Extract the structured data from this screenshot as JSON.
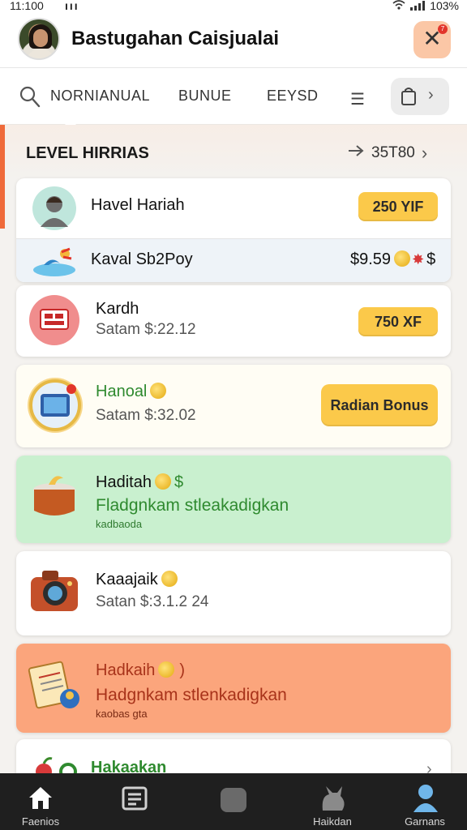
{
  "status_bar": {
    "time": "11:100",
    "icons_left": "ııı",
    "battery": "103%"
  },
  "header": {
    "title": "Bastugahan Caisjualai",
    "notification_count": "7"
  },
  "tabs": {
    "items": [
      {
        "label": "NORNIANUAL"
      },
      {
        "label": "BUNUE"
      },
      {
        "label": "EEYSD"
      }
    ]
  },
  "section": {
    "label": "LEVEL HIRRIAS",
    "right_value": "35T80"
  },
  "cards": [
    {
      "title": "Havel Hariah",
      "badge": "250 YIF"
    },
    {
      "title": "Kaval Sb2Poy",
      "value": "$9.59",
      "value_suffix": "$"
    },
    {
      "title": "Kardh",
      "subtitle": "Satam $:22.12",
      "badge": "750 XF"
    },
    {
      "title": "Hanoal",
      "subtitle": "Satam $:32.02",
      "badge": "Radian Bonus"
    },
    {
      "title": "Haditah",
      "title_suffix": "$",
      "subtitle": "Fladgnkam stleakadigkan",
      "small": "kadbaoda"
    },
    {
      "title": "Kaaajaik",
      "subtitle": "Satan $:3.1.2 24"
    },
    {
      "title": "Hadkaih",
      "title_suffix": ")",
      "subtitle": "Hadgnkam stlenkadigkan",
      "small": "kaobas gta"
    },
    {
      "title": "Hakaakan"
    }
  ],
  "bottom_nav": [
    {
      "label": "Faenios",
      "icon": "home-icon"
    },
    {
      "label": "",
      "icon": "news-icon"
    },
    {
      "label": "",
      "icon": "square-icon"
    },
    {
      "label": "Haikdan",
      "icon": "cat-icon"
    },
    {
      "label": "Garnans",
      "icon": "person-icon"
    }
  ],
  "colors": {
    "accent": "#ef6a3a",
    "badge": "#fbc94a",
    "green_card": "#c9f0cf",
    "orange_card": "#fba57c"
  }
}
